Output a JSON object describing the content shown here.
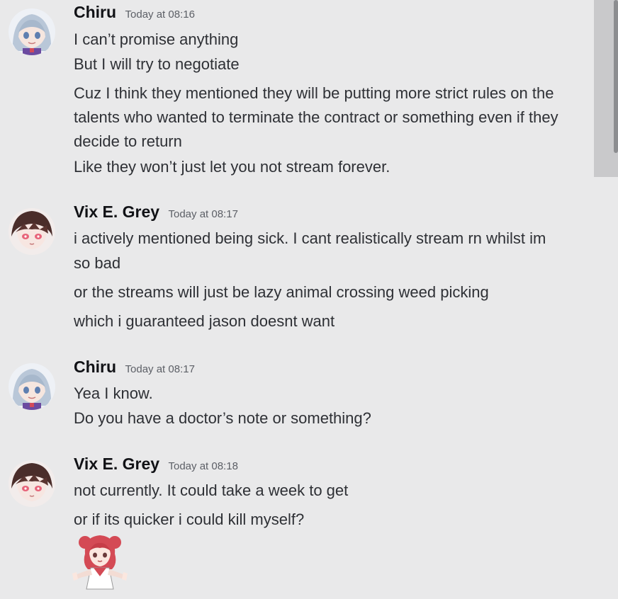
{
  "messages": [
    {
      "author": "Chiru",
      "timestamp": "Today at 08:16",
      "avatar": "chiru-avatar",
      "lines": [
        "I can’t promise anything",
        "But I will try to negotiate",
        "Cuz I think they mentioned they will be putting more strict rules on the",
        "talents who wanted to terminate the contract or something even if they",
        "decide to return",
        "Like they won’t just let you not stream forever."
      ]
    },
    {
      "author": "Vix E. Grey",
      "timestamp": "Today at 08:17",
      "avatar": "vix-avatar",
      "lines": [
        "i actively mentioned being sick. I cant realistically stream rn whilst im",
        "so bad",
        "or the streams will just be lazy animal crossing weed picking",
        "which i guaranteed jason doesnt want"
      ]
    },
    {
      "author": "Chiru",
      "timestamp": "Today at 08:17",
      "avatar": "chiru-avatar",
      "lines": [
        "Yea I know.",
        "Do you have a doctor’s note or something?"
      ]
    },
    {
      "author": "Vix E. Grey",
      "timestamp": "Today at 08:18",
      "avatar": "vix-avatar",
      "lines": [
        "not currently. It could take a week to get",
        "or if its quicker i could kill myself?"
      ],
      "sticker": "anime-girl-shrug-sticker"
    }
  ],
  "colors": {
    "background": "#e9e9ea",
    "author": "#111216",
    "text": "#2e3035",
    "timestamp": "#5c5f66"
  }
}
